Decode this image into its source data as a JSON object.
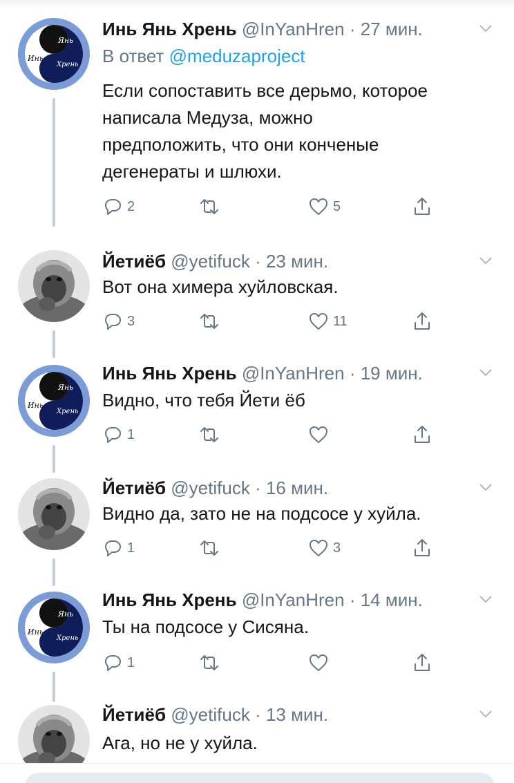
{
  "thread": [
    {
      "author": "Инь Янь Хрень",
      "handle": "@InYanHren",
      "time": "27 мин.",
      "avatar": "yinyang-avatar",
      "avatar_labels": [
        "Янь",
        "Инь",
        "Хрень"
      ],
      "reply_prefix": "В ответ",
      "reply_to": "@meduzaproject",
      "text_lines": [
        "Если сопоставить все дерьмо, которое",
        "написала Медуза, можно",
        "предположить, что они конченые",
        "дегенераты и шлюхи."
      ],
      "replies": "2",
      "retweets": "",
      "likes": "5"
    },
    {
      "author": "Йетиёб",
      "handle": "@yetifuck",
      "time": "23 мин.",
      "avatar": "yeti-avatar",
      "text_lines": [
        "Вот она химера хуйловская."
      ],
      "replies": "3",
      "retweets": "",
      "likes": "11"
    },
    {
      "author": "Инь Янь Хрень",
      "handle": "@InYanHren",
      "time": "19 мин.",
      "avatar": "yinyang-avatar",
      "avatar_labels": [
        "Янь",
        "Инь",
        "Хрень"
      ],
      "text_lines": [
        "Видно, что тебя Йети ёб"
      ],
      "replies": "1",
      "retweets": "",
      "likes": ""
    },
    {
      "author": "Йетиёб",
      "handle": "@yetifuck",
      "time": "16 мин.",
      "avatar": "yeti-avatar",
      "text_lines": [
        "Видно да, зато не на подсосе у хуйла."
      ],
      "replies": "1",
      "retweets": "",
      "likes": "3"
    },
    {
      "author": "Инь Янь Хрень",
      "handle": "@InYanHren",
      "time": "14 мин.",
      "avatar": "yinyang-avatar",
      "avatar_labels": [
        "Янь",
        "Инь",
        "Хрень"
      ],
      "text_lines": [
        "Ты на подсосе у Сисяна."
      ],
      "replies": "1",
      "retweets": "",
      "likes": ""
    },
    {
      "author": "Йетиёб",
      "handle": "@yetifuck",
      "time": "13 мин.",
      "avatar": "yeti-avatar",
      "text_lines": [
        "Ага, но не у хуйла."
      ]
    }
  ],
  "separator": "·",
  "colors": {
    "text": "#14171a",
    "secondary": "#657786",
    "link": "#1da1f2",
    "thread_line": "#c4cbd3"
  },
  "icons": {
    "reply": "reply-icon",
    "retweet": "retweet-icon",
    "like": "heart-icon",
    "share": "share-icon",
    "more": "chevron-down-icon"
  }
}
